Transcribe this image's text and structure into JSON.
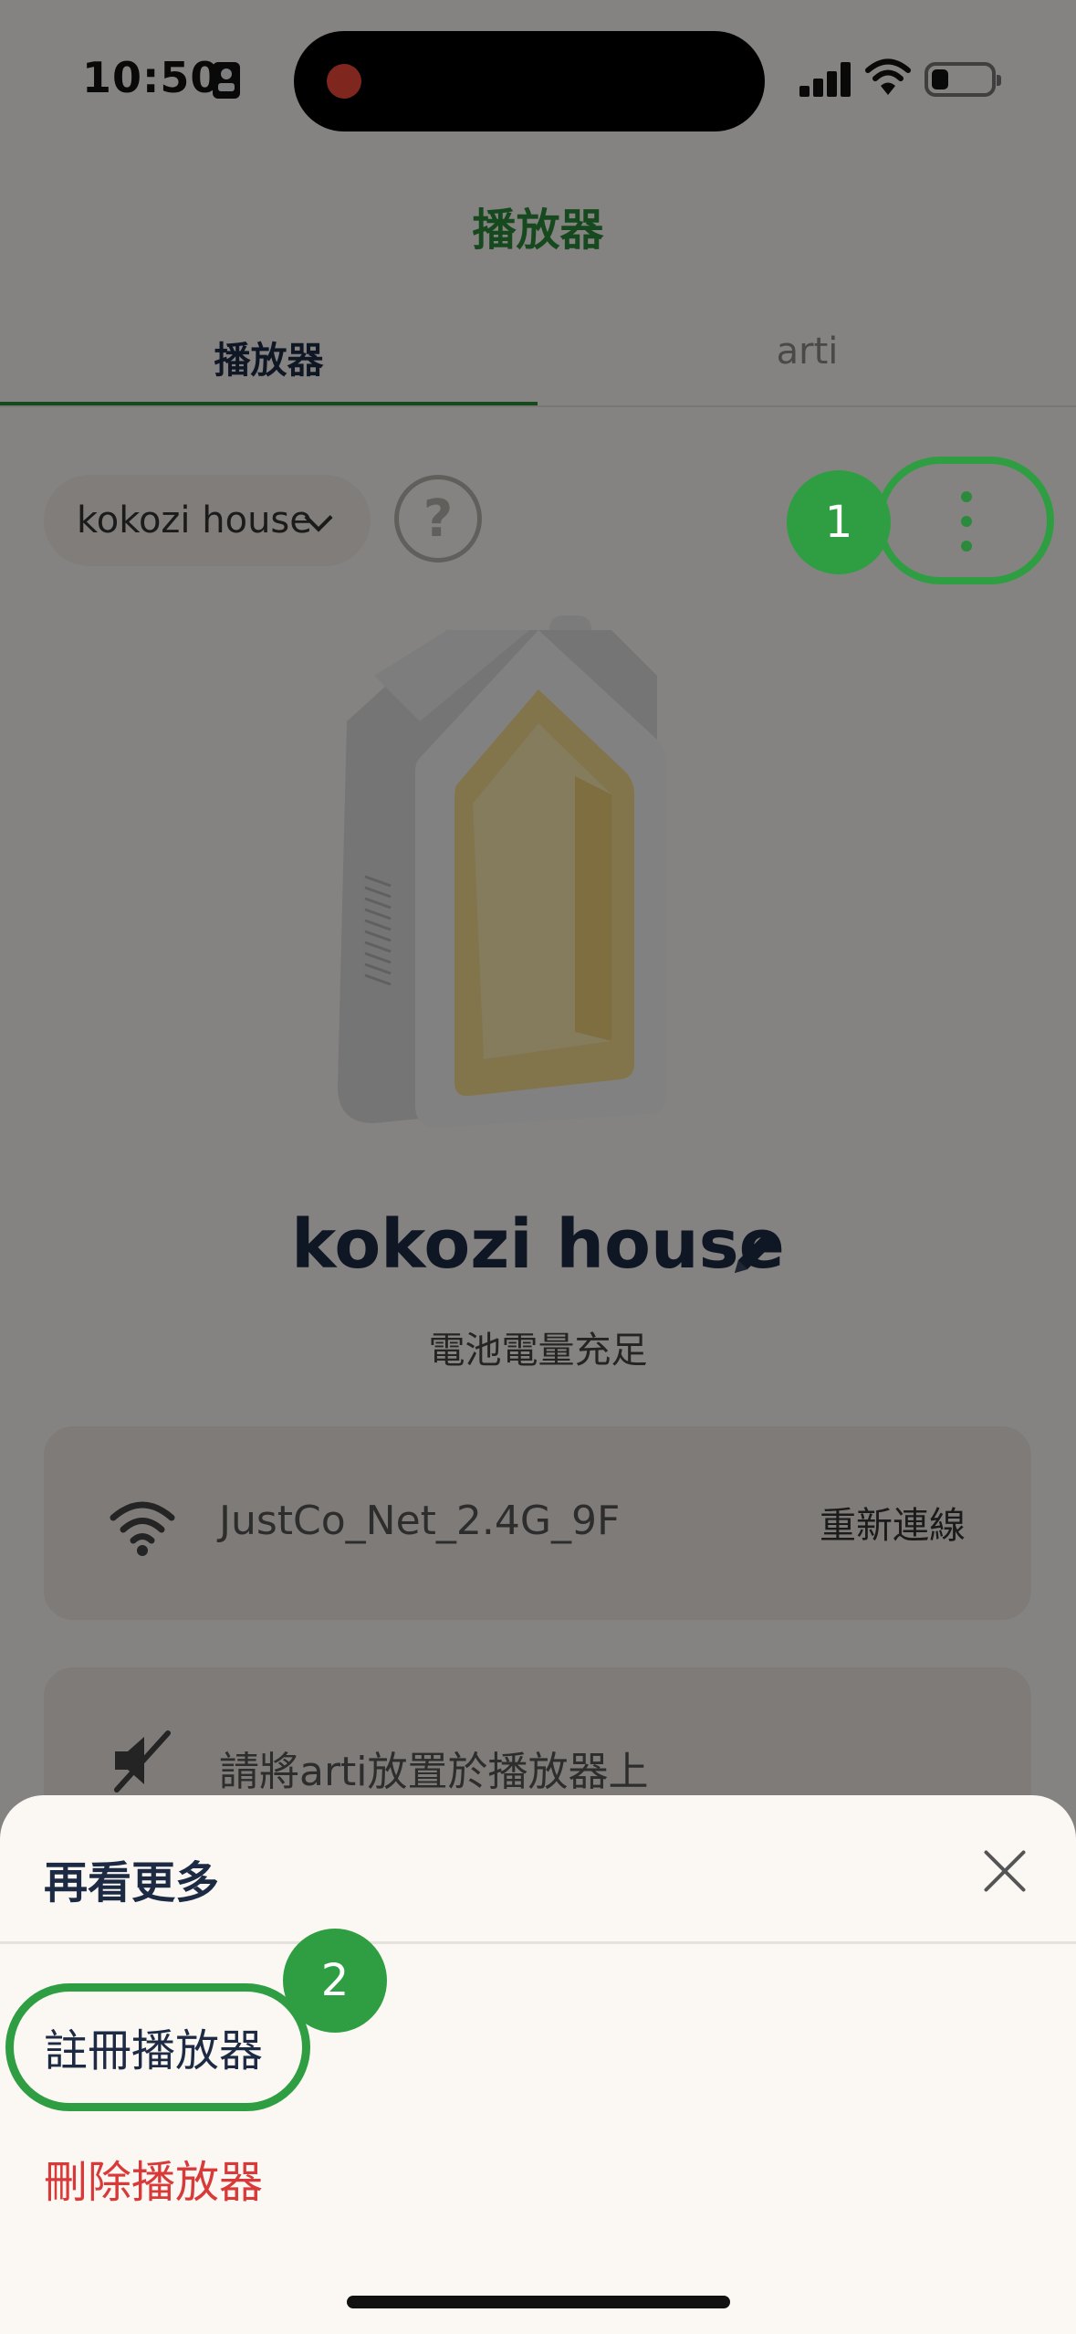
{
  "status_bar": {
    "time": "10:50"
  },
  "header": {
    "title": "播放器"
  },
  "tabs": [
    {
      "label": "播放器",
      "active": true
    },
    {
      "label": "arti",
      "active": false
    }
  ],
  "device_selector": {
    "value": "kokozi house"
  },
  "help": {
    "label": "?"
  },
  "device": {
    "name": "kokozi house",
    "battery_status": "電池電量充足"
  },
  "wifi_card": {
    "network": "JustCo_Net_2.4G_9F",
    "action": "重新連線"
  },
  "arti_card": {
    "message": "請將arti放置於播放器上"
  },
  "annotations": {
    "step1": "1",
    "step2": "2"
  },
  "sheet": {
    "title": "再看更多",
    "items": [
      {
        "label": "註冊播放器"
      },
      {
        "label": "刪除播放器"
      }
    ]
  },
  "colors": {
    "accent": "#2c8a3c",
    "danger": "#d83a3a",
    "text": "#1d2a44",
    "background": "#fbf8f3"
  }
}
